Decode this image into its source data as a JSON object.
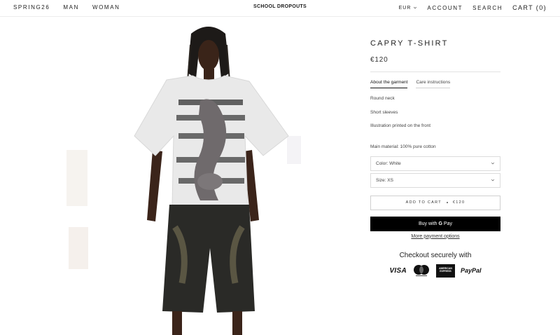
{
  "header": {
    "nav_left": [
      "SPRING26",
      "MAN",
      "WOMAN"
    ],
    "brand": "SCHOOL DROPOUTS",
    "currency": "EUR",
    "account": "ACCOUNT",
    "search": "SEARCH",
    "cart": "CART (0)"
  },
  "product": {
    "title": "CAPRY T-SHIRT",
    "price": "€120",
    "tabs": [
      "About the garment",
      "Care instructions"
    ],
    "description": [
      "Round neck",
      "Short sleeves",
      "Illustration printed on the front"
    ],
    "material": "Main material: 100% pure cotton",
    "color_select": "Color: White",
    "size_select": "Size: XS",
    "add_to_cart": "ADD TO CART",
    "add_to_cart_price": "€120",
    "buy_with": "Buy with",
    "gpay_g": "G",
    "gpay_pay": "Pay",
    "more_payment": "More payment options"
  },
  "checkout": {
    "heading": "Checkout securely with",
    "visa": "VISA",
    "amex_line1": "AMERICAN",
    "amex_line2": "EXPRESS",
    "paypal": "PayPal"
  },
  "icons": {
    "currency_dropdown": "chevron-down-icon",
    "select_dropdown": "chevron-down-icon",
    "mastercard": "mastercard-icon"
  }
}
